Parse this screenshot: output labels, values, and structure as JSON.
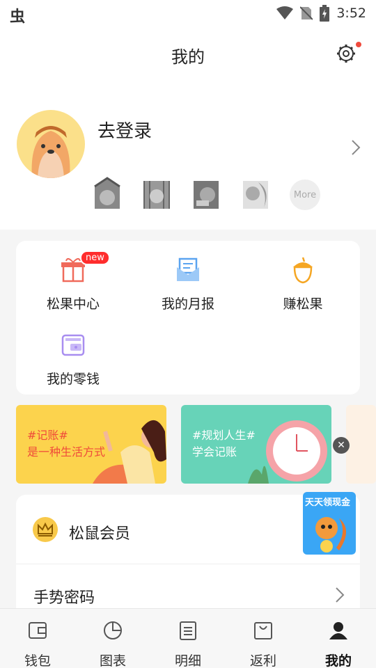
{
  "status_bar": {
    "app_glyph": "虫",
    "time": "3:52"
  },
  "header": {
    "title": "我的"
  },
  "profile": {
    "login_text": "去登录",
    "badges": [
      "badge-1",
      "badge-2",
      "badge-3",
      "badge-4"
    ],
    "more_label": "More"
  },
  "features": [
    {
      "label": "松果中心",
      "icon": "gift-icon",
      "badge": "new"
    },
    {
      "label": "我的月报",
      "icon": "report-icon"
    },
    {
      "label": "赚松果",
      "icon": "acorn-icon"
    },
    {
      "label": "我的零钱",
      "icon": "wallet-icon"
    }
  ],
  "banners": [
    {
      "line1": "#记账#",
      "line2": "是一种生活方式"
    },
    {
      "line1": "#规划人生#",
      "line2": "学会记账"
    }
  ],
  "member": {
    "label": "松鼠会员",
    "promo_text": "天天领现金"
  },
  "settings_list": [
    {
      "label": "手势密码"
    }
  ],
  "tabbar": [
    {
      "label": "钱包",
      "icon": "wallet-tab-icon"
    },
    {
      "label": "图表",
      "icon": "chart-tab-icon"
    },
    {
      "label": "明细",
      "icon": "list-tab-icon"
    },
    {
      "label": "返利",
      "icon": "bag-tab-icon"
    },
    {
      "label": "我的",
      "icon": "user-tab-icon",
      "active": true
    }
  ],
  "colors": {
    "accent": "#f8c94a",
    "badge_red": "#ff2d2d",
    "banner1": "#fcd34d",
    "banner2": "#67d3b8"
  }
}
